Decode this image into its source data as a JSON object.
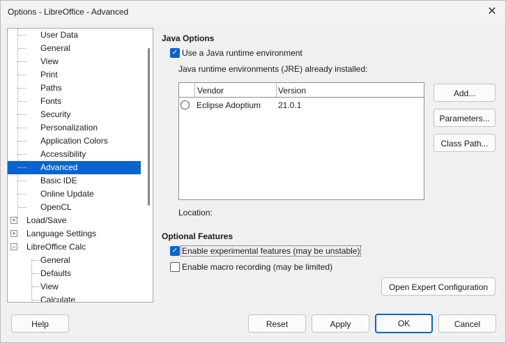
{
  "window": {
    "title": "Options - LibreOffice - Advanced",
    "close_label": "✕"
  },
  "tree": {
    "items": [
      {
        "label": "User Data"
      },
      {
        "label": "General"
      },
      {
        "label": "View"
      },
      {
        "label": "Print"
      },
      {
        "label": "Paths"
      },
      {
        "label": "Fonts"
      },
      {
        "label": "Security"
      },
      {
        "label": "Personalization"
      },
      {
        "label": "Application Colors"
      },
      {
        "label": "Accessibility"
      },
      {
        "label": "Advanced"
      },
      {
        "label": "Basic IDE"
      },
      {
        "label": "Online Update"
      },
      {
        "label": "OpenCL"
      },
      {
        "label": "Load/Save"
      },
      {
        "label": "Language Settings"
      },
      {
        "label": "LibreOffice Calc"
      },
      {
        "label": "General"
      },
      {
        "label": "Defaults"
      },
      {
        "label": "View"
      },
      {
        "label": "Calculate"
      }
    ],
    "expanders": {
      "collapsed": "+",
      "expanded": "−"
    }
  },
  "java": {
    "section_title": "Java Options",
    "use_jre_label": "Use a Java runtime environment",
    "installed_label": "Java runtime environments (JRE) already installed:",
    "columns": {
      "vendor": "Vendor",
      "version": "Version"
    },
    "rows": [
      {
        "vendor": "Eclipse Adoptium",
        "version": "21.0.1"
      }
    ],
    "location_label": "Location:",
    "add_button": "Add...",
    "parameters_button": "Parameters...",
    "classpath_button": "Class Path..."
  },
  "optional": {
    "section_title": "Optional Features",
    "experimental_label": "Enable experimental features (may be unstable)",
    "macro_label": "Enable macro recording (may be limited)",
    "expert_button": "Open Expert Configuration"
  },
  "footer": {
    "help": "Help",
    "reset": "Reset",
    "apply": "Apply",
    "ok": "OK",
    "cancel": "Cancel"
  },
  "checkmark": "✓",
  "colors": {
    "accent": "#0a64d0"
  }
}
